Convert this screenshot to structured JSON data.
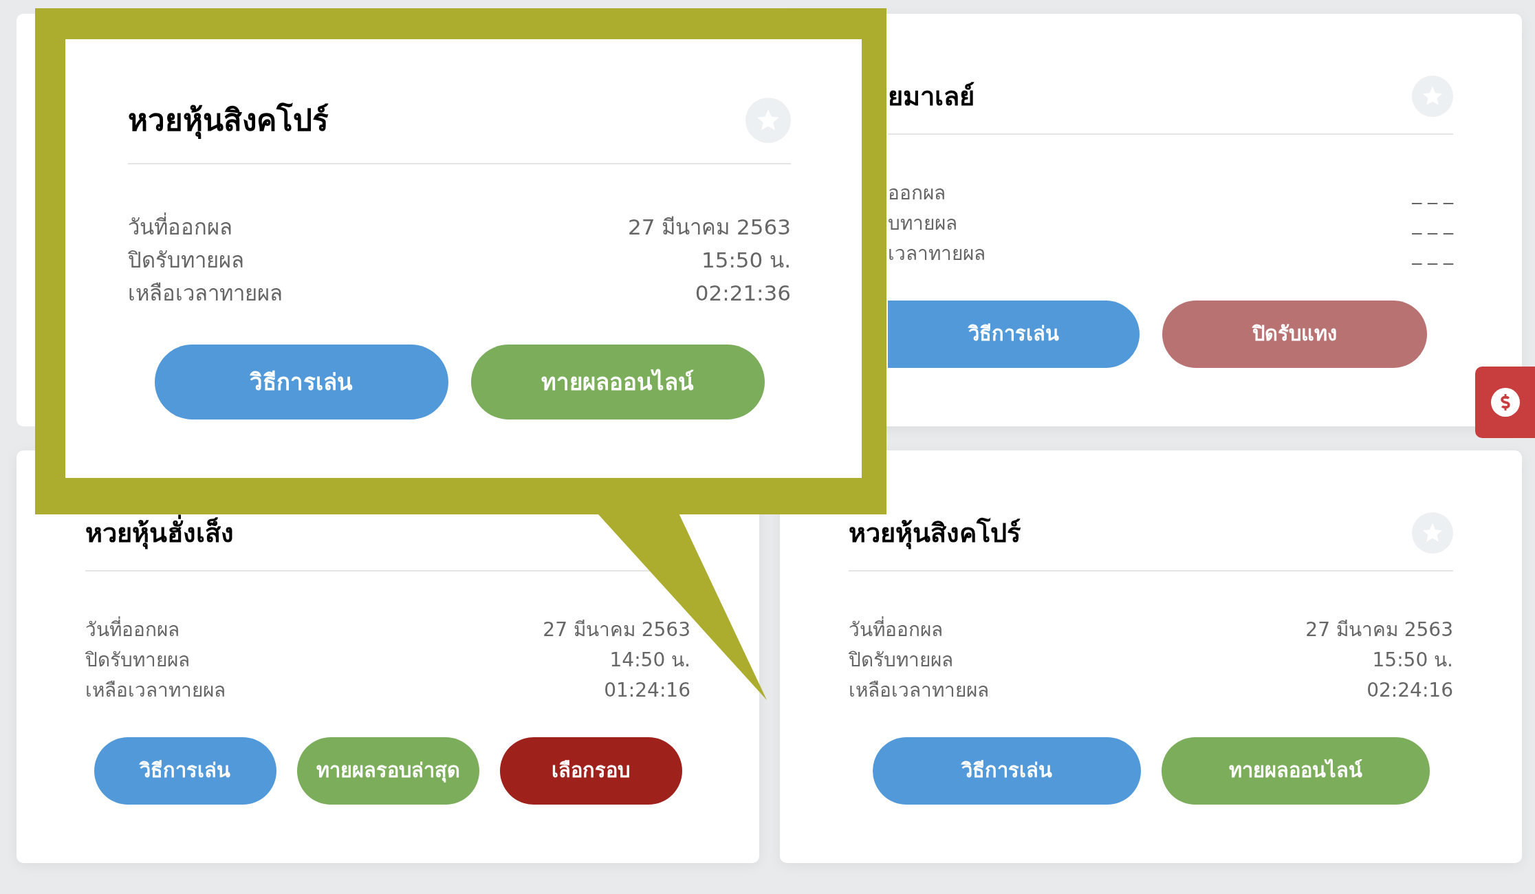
{
  "callout": {
    "title": "หวยหุ้นสิงคโปร์",
    "rows": [
      {
        "label": "วันที่ออกผล",
        "value": "27 มีนาคม 2563"
      },
      {
        "label": "ปิดรับทายผล",
        "value": "15:50 น."
      },
      {
        "label": "เหลือเวลาทายผล",
        "value": "02:21:36"
      }
    ],
    "buttons": [
      {
        "label": "วิธีการเล่น",
        "kind": "info"
      },
      {
        "label": "ทายผลออนไลน์",
        "kind": "play"
      }
    ]
  },
  "partial_card": {
    "title": "ยมาเลย์",
    "rows": [
      {
        "label": "ออกผล",
        "value": "_ _ _"
      },
      {
        "label": "บทายผล",
        "value": "_ _ _"
      },
      {
        "label": "เวลาทายผล",
        "value": "_ _ _"
      }
    ],
    "buttons": [
      {
        "label": "วิธีการเล่น",
        "kind": "info"
      },
      {
        "label": "ปิดรับแทง",
        "kind": "closed"
      }
    ]
  },
  "cards": [
    {
      "title": "หวยหุ้นฮั่งเส็ง",
      "rows": [
        {
          "label": "วันที่ออกผล",
          "value": "27 มีนาคม 2563"
        },
        {
          "label": "ปิดรับทายผล",
          "value": "14:50 น."
        },
        {
          "label": "เหลือเวลาทายผล",
          "value": "01:24:16"
        }
      ],
      "buttons": [
        {
          "label": "วิธีการเล่น",
          "kind": "info"
        },
        {
          "label": "ทายผลรอบล่าสุด",
          "kind": "play"
        },
        {
          "label": "เลือกรอบ",
          "kind": "round"
        }
      ]
    },
    {
      "title": "หวยหุ้นสิงคโปร์",
      "rows": [
        {
          "label": "วันที่ออกผล",
          "value": "27 มีนาคม 2563"
        },
        {
          "label": "ปิดรับทายผล",
          "value": "15:50 น."
        },
        {
          "label": "เหลือเวลาทายผล",
          "value": "02:24:16"
        }
      ],
      "buttons": [
        {
          "label": "วิธีการเล่น",
          "kind": "info"
        },
        {
          "label": "ทายผลออนไลน์",
          "kind": "play"
        }
      ]
    }
  ]
}
